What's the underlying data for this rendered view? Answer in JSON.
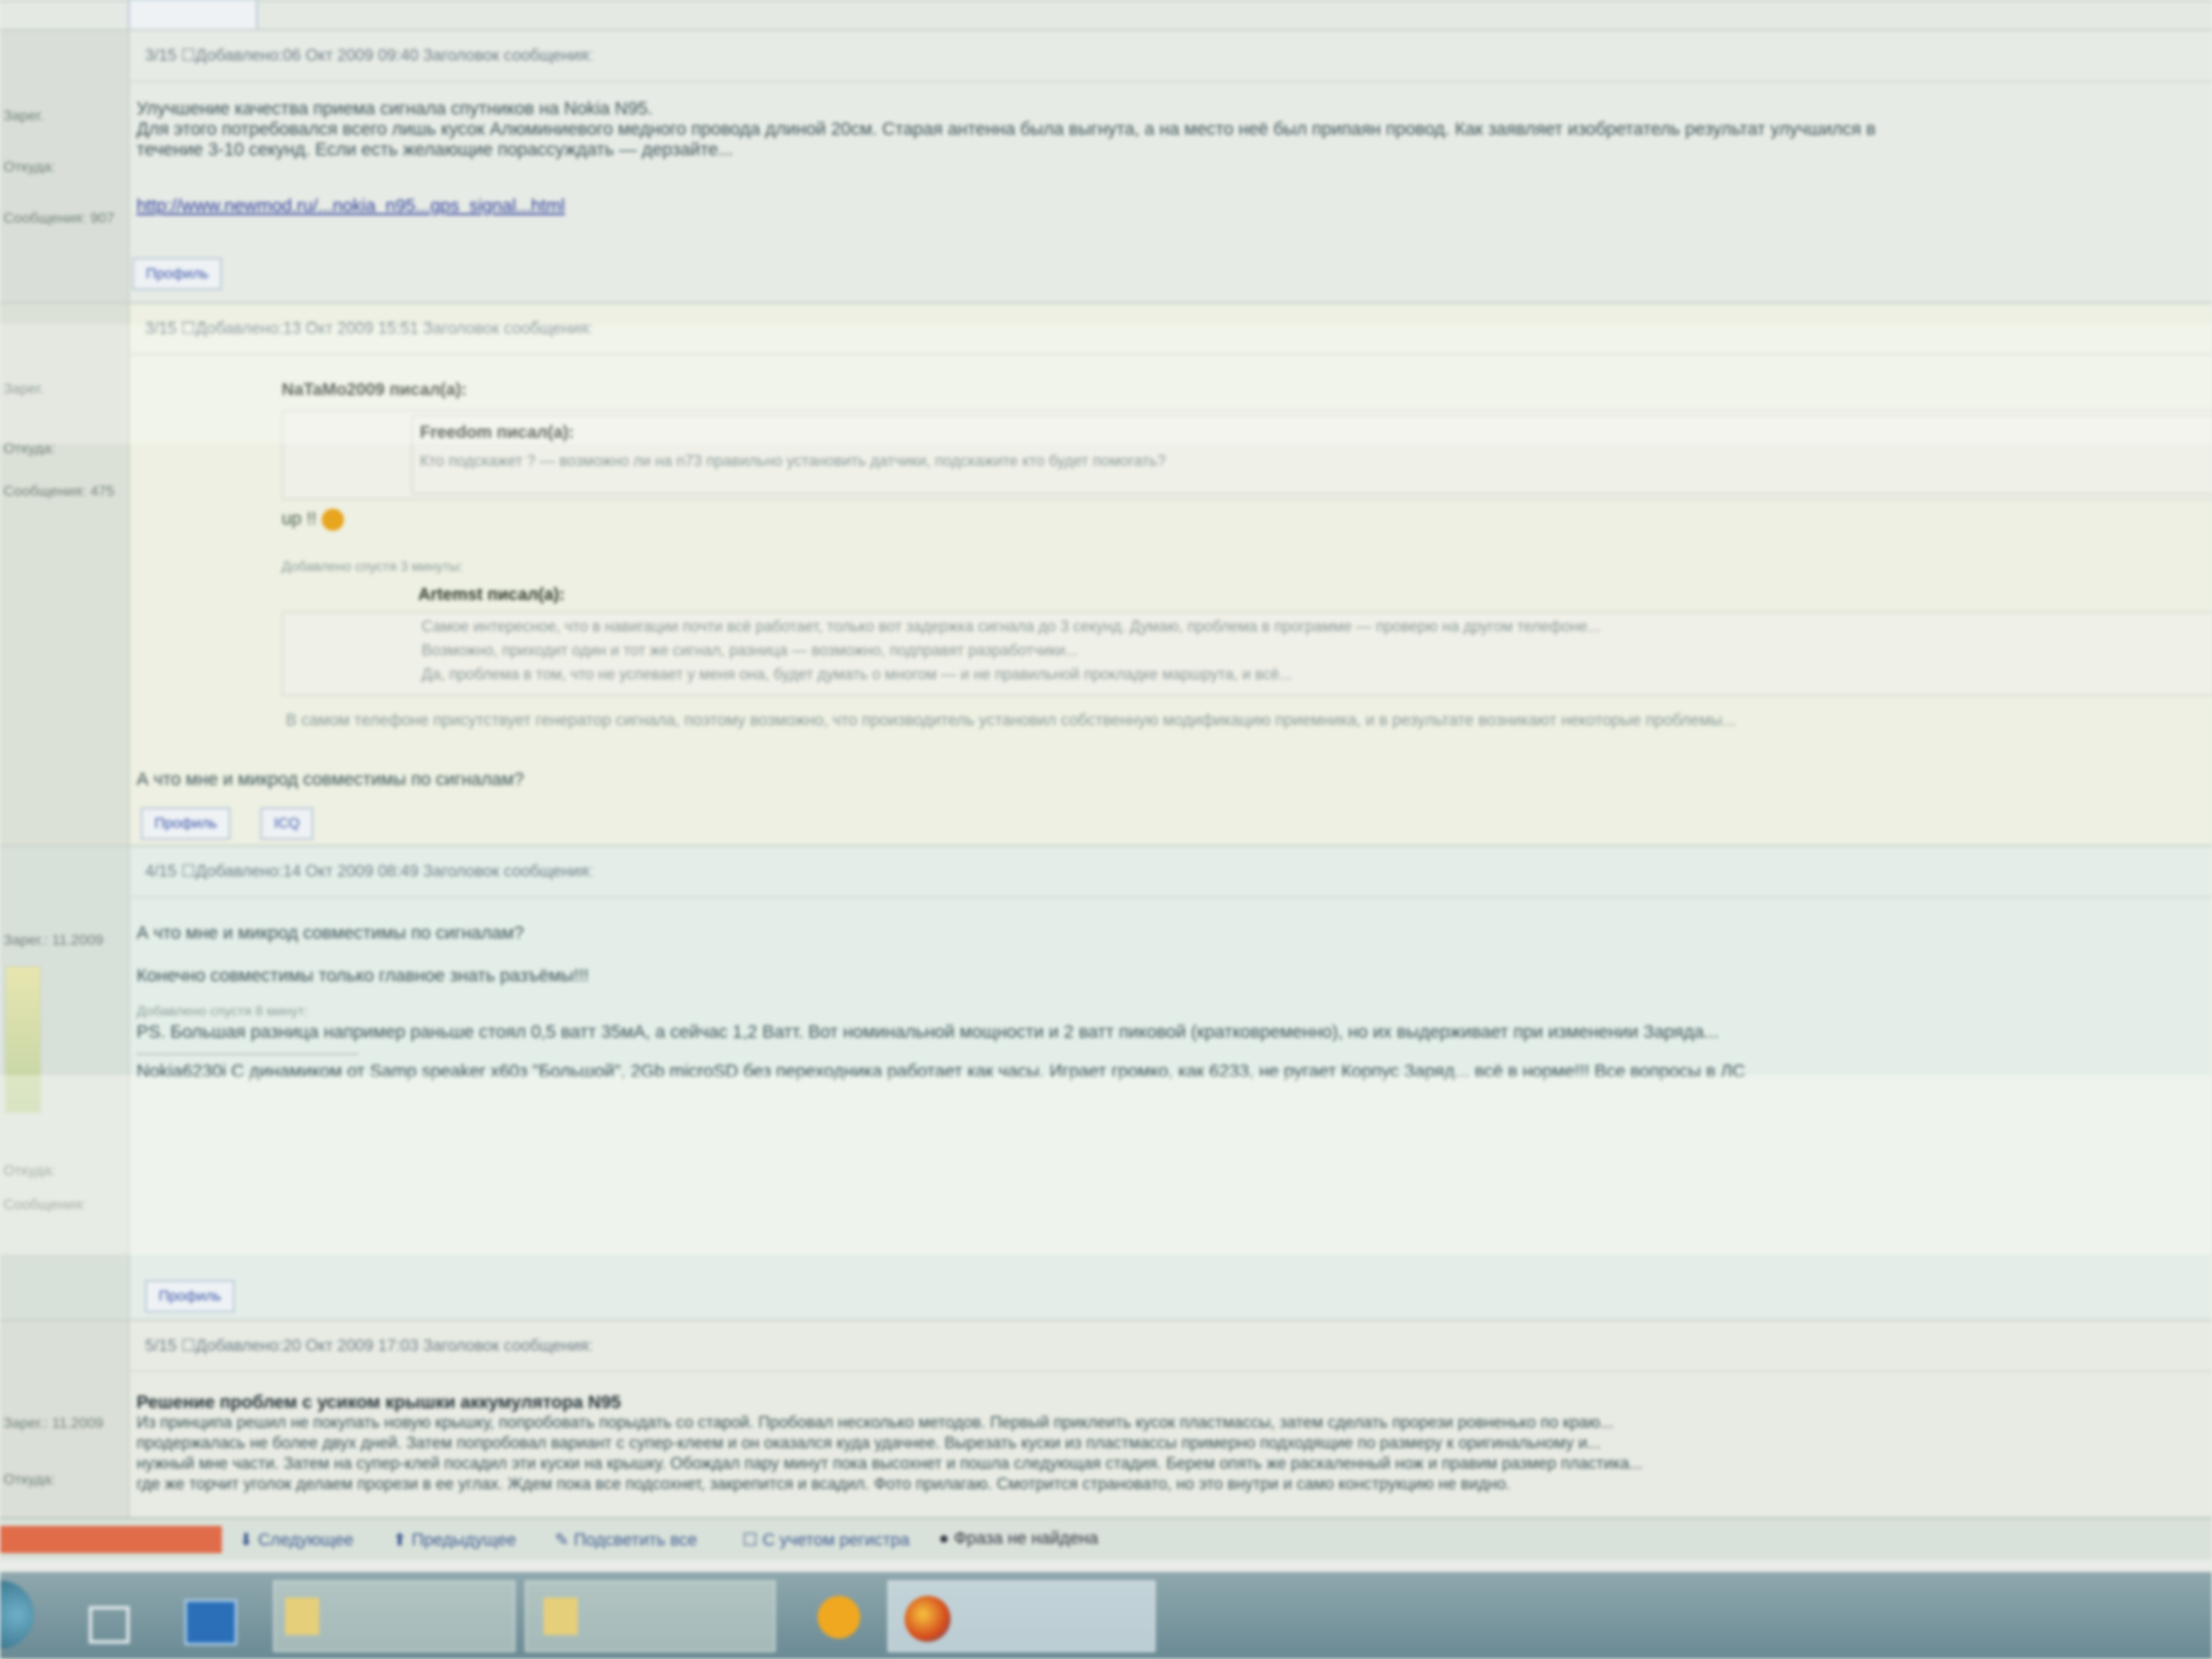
{
  "posts": [
    {
      "header": "3/15 ☐Добавлено:06 Окт 2009 09:40   Заголовок сообщения:",
      "meta": [
        "Зарег.",
        "Откуда:",
        "Сообщения: 907"
      ],
      "lines": [
        "Улучшение качества приема сигнала спутников на Nokia N95.",
        "Для этого потребовался всего лишь кусок Алюминиевого медного провода длиной 20см. Старая антенна была выгнута, а на место неё был припаян провод. Как заявляет изобретатель результат улучшился в",
        "течение 3-10 секунд. Если есть желающие порассуждать — дерзайте..."
      ],
      "link": "http://www.newmod.ru/...nokia_n95...gps_signal...html",
      "buttons": [
        "Профиль"
      ]
    },
    {
      "header": "3/15 ☐Добавлено:13 Окт 2009 15:51   Заголовок сообщения:",
      "meta": [
        "Зарег.",
        "Откуда:",
        "Сообщения: 475"
      ],
      "quote1_author": "NaTaMo2009 писал(а):",
      "quote1_inner_author": "Freedom писал(а):",
      "quote1_inner_text": "Кто подскажет ? — возможно ли на n73 правильно установить датчики, подскажите кто будет помогать?",
      "up_text": "up !!",
      "added_note": "Добавлено спустя 3 минуты:",
      "quote2_author": "Artemst писал(а):",
      "quote2_lines": [
        "Самое интересное, что в навигации почти всё работает, только вот задержка сигнала до 3 секунд. Думаю, проблема в программе — проверю на другом телефоне...",
        "Возможно, приходит один и тот же сигнал, разница — возможно, подправят разработчики...",
        "Да, проблема в том, что не успевает у меня она, будет думать о многом — и не правильной прокладке маршрута, и всё..."
      ],
      "long_line": "В самом телефоне присутствует генератор сигнала, поэтому возможно, что производитель установил собственную модификацию приемника, и в результате возникают некоторые проблемы...",
      "question": "А что мне и микрод совместимы по сигналам?",
      "buttons": [
        "Профиль",
        "ICQ"
      ]
    },
    {
      "header": "4/15 ☐Добавлено:14 Окт 2009 08:49   Заголовок сообщения:",
      "meta": [
        "Зарег.: 11.2009",
        "Откуда:",
        "Сообщения:"
      ],
      "question": "А что мне и микрод совместимы по сигналам?",
      "answer": "Конечно совместимы только главное знать разъёмы!!!",
      "added_note": "Добавлено спустя 8 минут:",
      "ps_line": "PS. Большая разница например раньше стоял 0,5 ватт 35мА, а сейчас 1,2 Ватт. Вот номинальной мощности и 2 ватт пиковой (кратковременно), но их выдерживает при изменении Заряда...",
      "signature": "Nokia6230i С динамиком от Samp speaker x60з \"Большой\", 2Gb microSD без переходника работает как часы. Играет громко, как 6233, не ругает Корпус Заряд... всё в норме!!! Все вопросы в ЛС",
      "buttons": [
        "Профиль"
      ]
    },
    {
      "header": "5/15 ☐Добавлено:20 Окт 2009 17:03   Заголовок сообщения:",
      "meta": [
        "Зарег.: 11.2009",
        "Откуда:"
      ],
      "title": "Решение проблем с усиком крышки аккумулятора N95",
      "lines": [
        "Из принципа решил не покупать новую крышку, попробовать порыдать со старой. Пробовал несколько методов. Первый приклеить кусок пластмассы, затем сделать прорези ровненько по краю...",
        "продержалась не более двух дней. Затем попробовал вариант с супер-клеем и он оказался куда удачнее. Вырезать куски из пластмассы примерно подходящие по размеру к оригинальному и...",
        "нужный мне части. Затем на супер-клей посадил эти куски на крышку. Обождал пару минут пока высохнет и пошла следующая стадия. Берем опять же раскаленный нож и правим размер пластика...",
        "где же торчит уголок делаем прорези в ее углах. Ждем пока все подсохнет, закрепится и всадил. Фото прилагаю. Смотрится страновато, но это внутри и само конструкцию не видно."
      ]
    }
  ],
  "findbar": {
    "next": "Следующее",
    "prev": "Предыдущее",
    "highlight": "Подсветить все",
    "match_case": "С учетом регистра",
    "status": "Фраза не найдена"
  },
  "taskbar": {
    "items": [
      "Start",
      "Explorer",
      "Folder 1",
      "Folder 2",
      "Media",
      "Firefox"
    ]
  },
  "colors": {
    "link": "#2e3f9c",
    "find_error": "#e06c4a",
    "taskbar": "#6a8a94"
  }
}
